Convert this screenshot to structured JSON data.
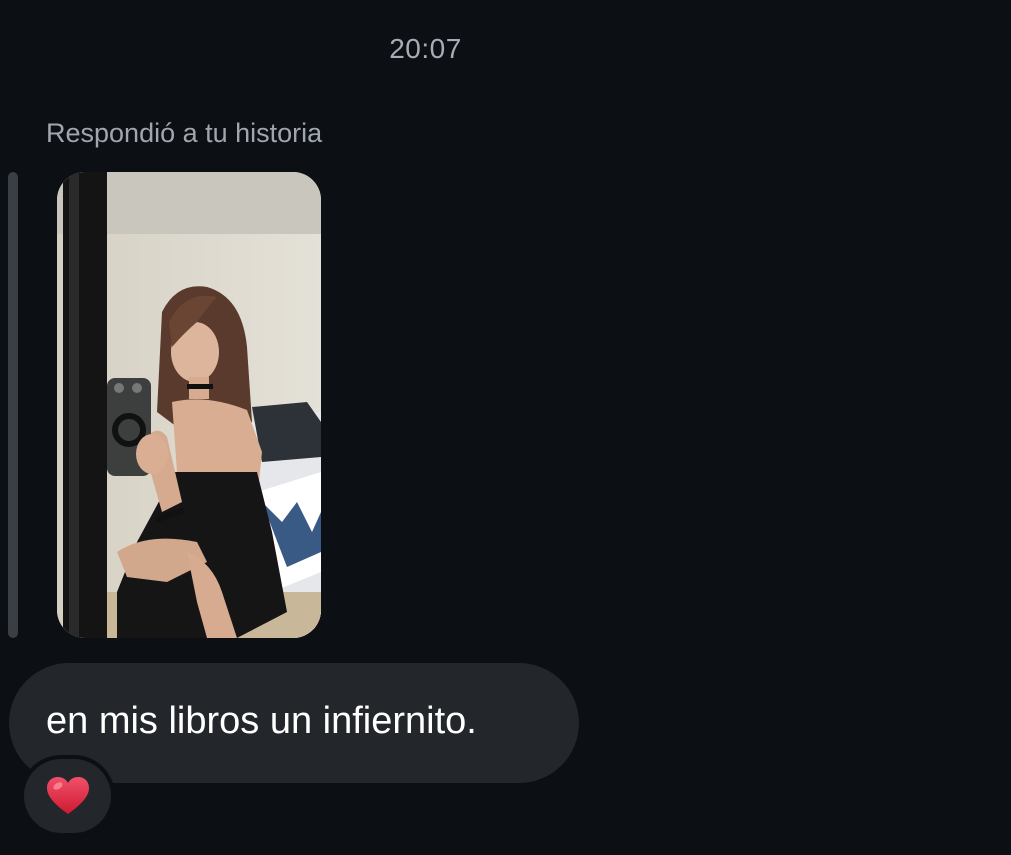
{
  "conversation": {
    "timestamp": "20:07",
    "reply_context": "Respondió a tu historia",
    "story": {
      "icon": "story-image",
      "description_icon": "mirror-selfie"
    },
    "message": {
      "text": "en mis libros un infiernito.",
      "bubble_color": "#23262b",
      "text_color": "#ffffff"
    },
    "reaction": {
      "icon": "red-heart-icon",
      "color": "#e0243a"
    }
  },
  "colors": {
    "background": "#0c0f14",
    "muted_text": "#a1a6ae",
    "reply_bar": "#3a3e45"
  }
}
